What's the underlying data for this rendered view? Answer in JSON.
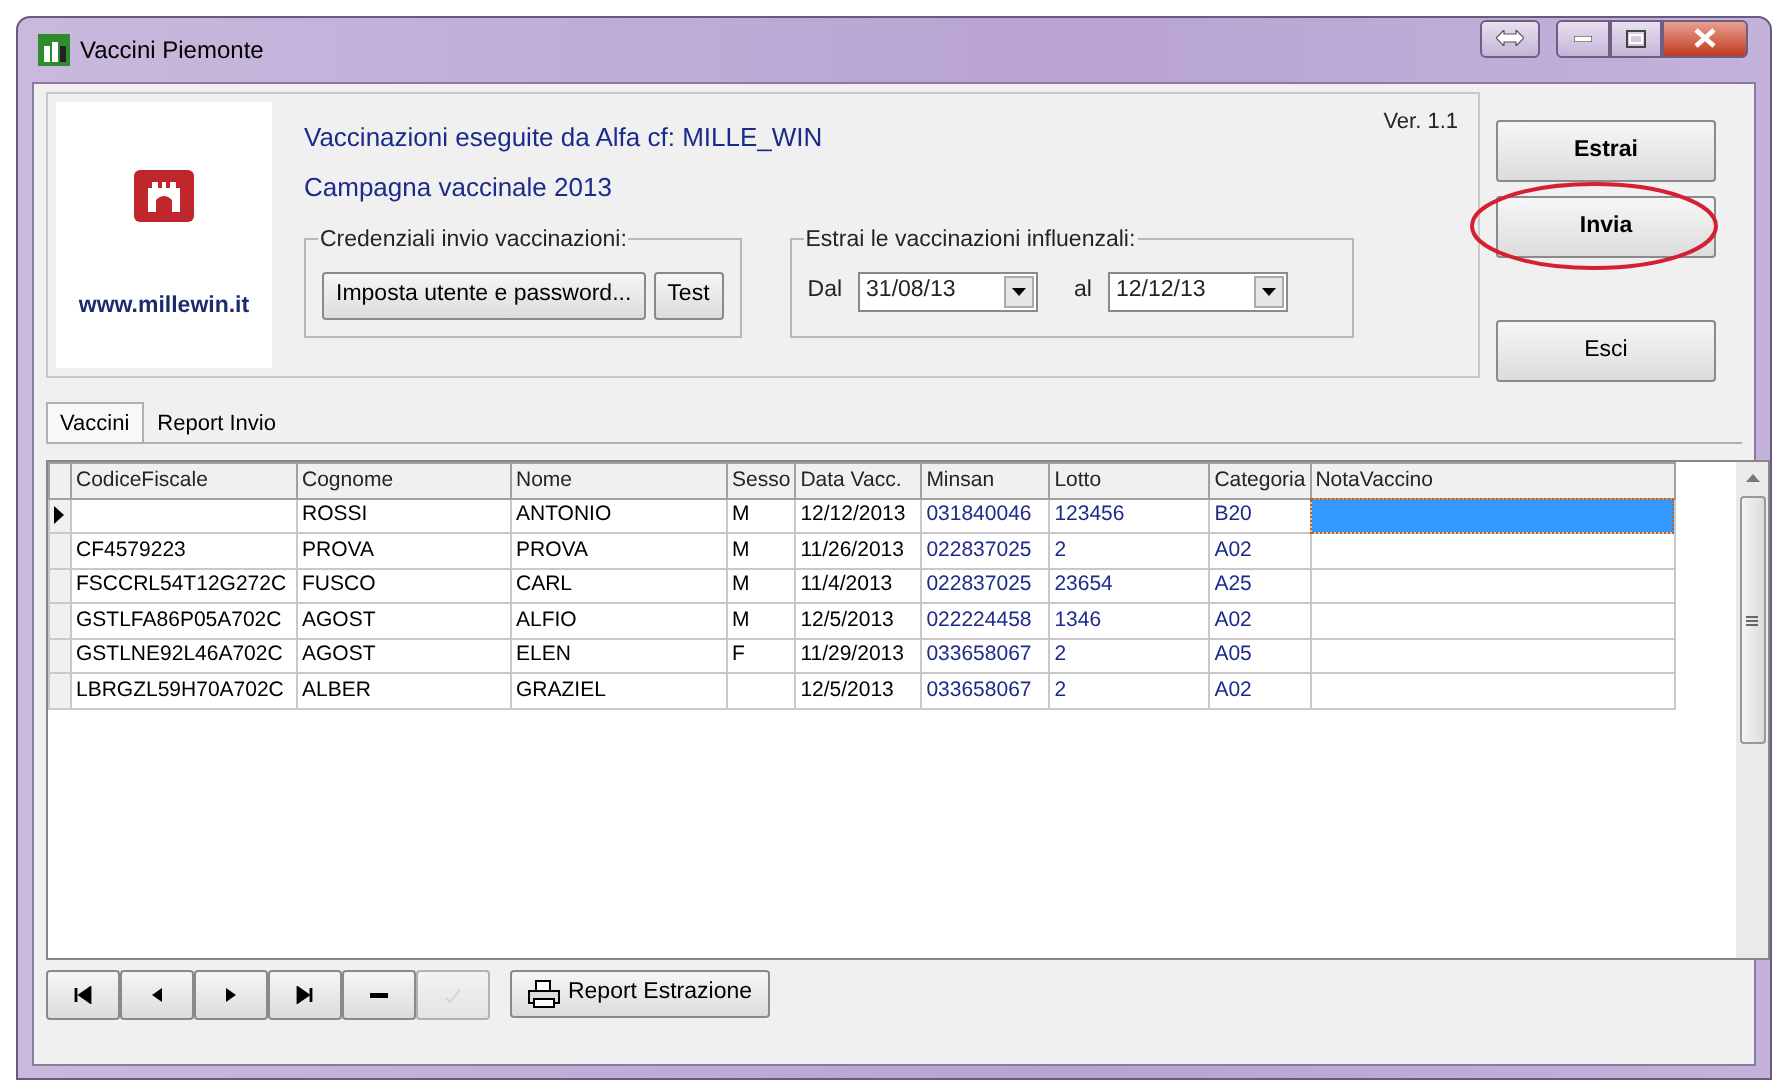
{
  "window": {
    "title": "Vaccini Piemonte"
  },
  "header": {
    "website": "www.millewin.it",
    "line1": "Vaccinazioni eseguite da  Alfa cf: MILLE_WIN",
    "line2": "Campagna vaccinale 2013",
    "version": "Ver. 1.1",
    "credentials": {
      "legend": "Credenziali invio vaccinazioni:",
      "buttons": [
        "Imposta utente e password...",
        "Test"
      ]
    },
    "extract": {
      "legend": "Estrai le vaccinazioni influenzali:",
      "from_label": "Dal",
      "from_value": "31/08/13",
      "to_label": "al",
      "to_value": "12/12/13"
    }
  },
  "side_buttons": [
    {
      "label": "Estrai",
      "bold": true,
      "highlighted": false
    },
    {
      "label": "Invia",
      "bold": true,
      "highlighted": true
    },
    {
      "label": "Esci",
      "bold": false,
      "highlighted": false
    }
  ],
  "tabs": [
    {
      "label": "Vaccini",
      "selected": true
    },
    {
      "label": "Report Invio",
      "selected": false
    }
  ],
  "table": {
    "columns": [
      {
        "label": "CodiceFiscale",
        "color": "#000000"
      },
      {
        "label": "Cognome",
        "color": "#000000"
      },
      {
        "label": "Nome",
        "color": "#000000"
      },
      {
        "label": "Sesso",
        "color": "#000000"
      },
      {
        "label": "Data Vacc.",
        "color": "#000000"
      },
      {
        "label": "Minsan",
        "color": "#1c2a8a"
      },
      {
        "label": "Lotto",
        "color": "#1c2a8a"
      },
      {
        "label": "Categoria",
        "color": "#1c2a8a"
      },
      {
        "label": "NotaVaccino"
      }
    ],
    "rows": [
      {
        "selected": true,
        "cells": [
          null,
          "ROSSI",
          "ANTONIO",
          "M",
          "12/12/2013",
          "031840046",
          "123456",
          "B20",
          null
        ]
      },
      {
        "selected": false,
        "cells": [
          "CF4579223",
          "PROVA",
          "PROVA",
          "M",
          "11/26/2013",
          "022837025",
          "2",
          "A02",
          null
        ]
      },
      {
        "selected": false,
        "cells": [
          "FSCCRL54T12G272C",
          "FUSCO",
          "CARL",
          "M",
          "11/4/2013",
          "022837025",
          "23654",
          "A25",
          null
        ]
      },
      {
        "selected": false,
        "cells": [
          "GSTLFA86P05A702C",
          "AGOST",
          "ALFIO",
          "M",
          "12/5/2013",
          "022224458",
          "1346",
          "A02",
          null
        ]
      },
      {
        "selected": false,
        "cells": [
          "GSTLNE92L46A702C",
          "AGOST",
          "ELEN",
          "F",
          "11/29/2013",
          "033658067",
          "2",
          "A05",
          null
        ]
      },
      {
        "selected": false,
        "cells": [
          "LBRGZL59H70A702C",
          "ALBER",
          "GRAZIEL",
          null,
          "12/5/2013",
          "033658067",
          "2",
          "A02",
          null
        ]
      }
    ]
  },
  "navigator": [
    {
      "kind": "first",
      "disabled": false
    },
    {
      "kind": "prev",
      "disabled": false
    },
    {
      "kind": "next",
      "disabled": false
    },
    {
      "kind": "last",
      "disabled": false
    },
    {
      "kind": "delete",
      "disabled": false
    },
    {
      "kind": "post",
      "disabled": true
    }
  ],
  "report_button": "Report Estrazione"
}
